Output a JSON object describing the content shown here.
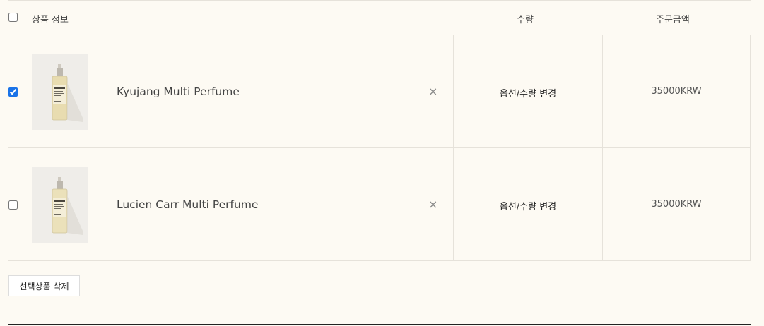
{
  "header": {
    "product_info": "상품 정보",
    "quantity": "수량",
    "order_amount": "주문금액"
  },
  "items": [
    {
      "name": "Kyujang Multi Perfume",
      "checked": true,
      "remove_label": "×",
      "option_link": "옵션/수량 변경",
      "price": "35000KRW"
    },
    {
      "name": "Lucien Carr Multi Perfume",
      "checked": false,
      "remove_label": "×",
      "option_link": "옵션/수량 변경",
      "price": "35000KRW"
    }
  ],
  "actions": {
    "delete_selected": "선택상품 삭제"
  },
  "colors": {
    "background": "#fdfaf3",
    "border": "#e6e2da",
    "checkbox_accent": "#1a73e8"
  }
}
